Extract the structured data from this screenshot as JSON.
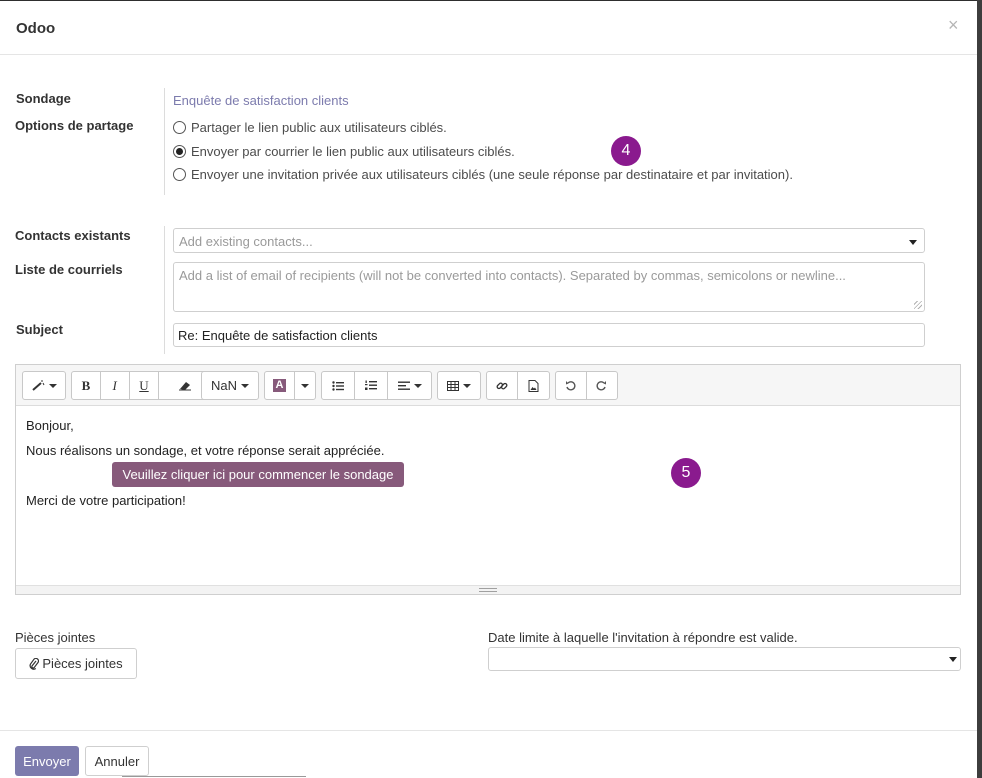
{
  "dialog": {
    "title": "Odoo",
    "close_glyph": "×"
  },
  "form": {
    "survey_label": "Sondage",
    "survey_value": "Enquête de satisfaction clients",
    "share_label": "Options de partage",
    "share_options": [
      {
        "label": "Partager le lien public aux utilisateurs ciblés.",
        "checked": false
      },
      {
        "label": "Envoyer par courrier le lien public aux utilisateurs ciblés.",
        "checked": true
      },
      {
        "label": "Envoyer une invitation privée aux utilisateurs ciblés (une seule réponse par destinataire et par invitation).",
        "checked": false
      }
    ],
    "contacts_label": "Contacts existants",
    "contacts_placeholder": "Add existing contacts...",
    "emails_label": "Liste de courriels",
    "emails_placeholder": "Add a list of email of recipients (will not be converted into contacts). Separated by commas, semicolons or newline...",
    "subject_label": "Subject",
    "subject_value": "Re: Enquête de satisfaction clients"
  },
  "badges": {
    "step4": "4",
    "step5": "5"
  },
  "toolbar": {
    "font_size": "NaN",
    "bold": "B",
    "italic": "I",
    "underline": "U",
    "color_glyph": "A",
    "icons": [
      "magic-wand-icon",
      "eraser-icon",
      "bullet-list-icon",
      "numbered-list-icon",
      "align-icon",
      "table-icon",
      "link-icon",
      "image-icon",
      "undo-icon",
      "redo-icon"
    ]
  },
  "editor": {
    "line1": "Bonjour,",
    "line2": "Nous réalisons un sondage, et votre réponse serait appréciée.",
    "button": "Veuillez cliquer ici pour commencer le sondage",
    "line3": "Merci de votre participation!"
  },
  "attachments": {
    "label": "Pièces jointes",
    "button": "Pièces jointes"
  },
  "deadline": {
    "label": "Date limite à laquelle l'invitation à répondre est valide."
  },
  "footer": {
    "send": "Envoyer",
    "cancel": "Annuler"
  },
  "colors": {
    "primary": "#7c7bad",
    "survey_button": "#875a7b",
    "badge": "#8a1a8e"
  }
}
